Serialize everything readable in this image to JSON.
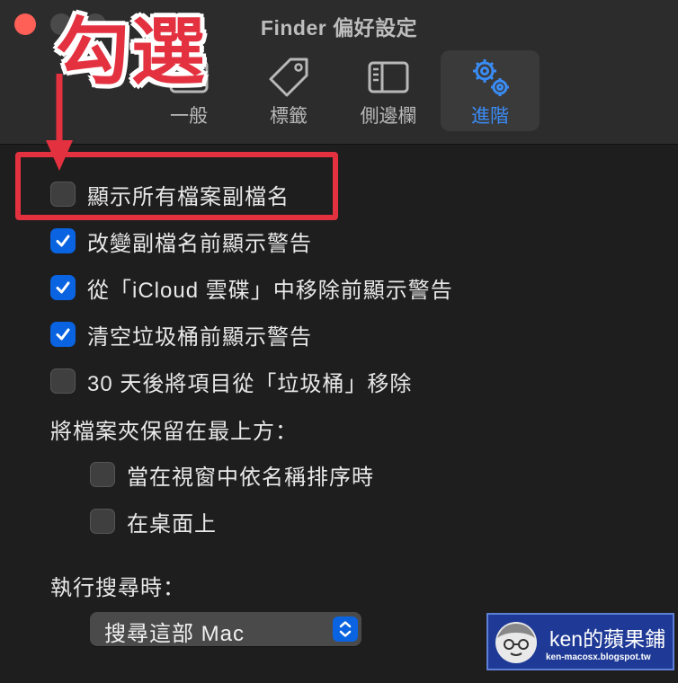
{
  "window": {
    "title": "Finder 偏好設定"
  },
  "tabs": [
    {
      "label": "一般",
      "icon": "general-icon",
      "selected": false
    },
    {
      "label": "標籤",
      "icon": "tag-icon",
      "selected": false
    },
    {
      "label": "側邊欄",
      "icon": "sidebar-icon",
      "selected": false
    },
    {
      "label": "進階",
      "icon": "gears-icon",
      "selected": true
    }
  ],
  "options": [
    {
      "label": "顯示所有檔案副檔名",
      "checked": false
    },
    {
      "label": "改變副檔名前顯示警告",
      "checked": true
    },
    {
      "label": "從「iCloud 雲碟」中移除前顯示警告",
      "checked": true
    },
    {
      "label": "清空垃圾桶前顯示警告",
      "checked": true
    },
    {
      "label": "30 天後將項目從「垃圾桶」移除",
      "checked": false
    }
  ],
  "folders_on_top": {
    "heading": "將檔案夾保留在最上方：",
    "options": [
      {
        "label": "當在視窗中依名稱排序時",
        "checked": false
      },
      {
        "label": "在桌面上",
        "checked": false
      }
    ]
  },
  "search": {
    "heading": "執行搜尋時：",
    "selected": "搜尋這部 Mac"
  },
  "annotation": {
    "text": "勾選",
    "color": "#e33140"
  },
  "watermark": {
    "title": "ken的蘋果鋪",
    "url": "ken-macosx.blogspot.tw"
  },
  "colors": {
    "accent": "#0a63e0",
    "selected_tab_text": "#3a8cf5",
    "background": "#1e1e1e"
  }
}
